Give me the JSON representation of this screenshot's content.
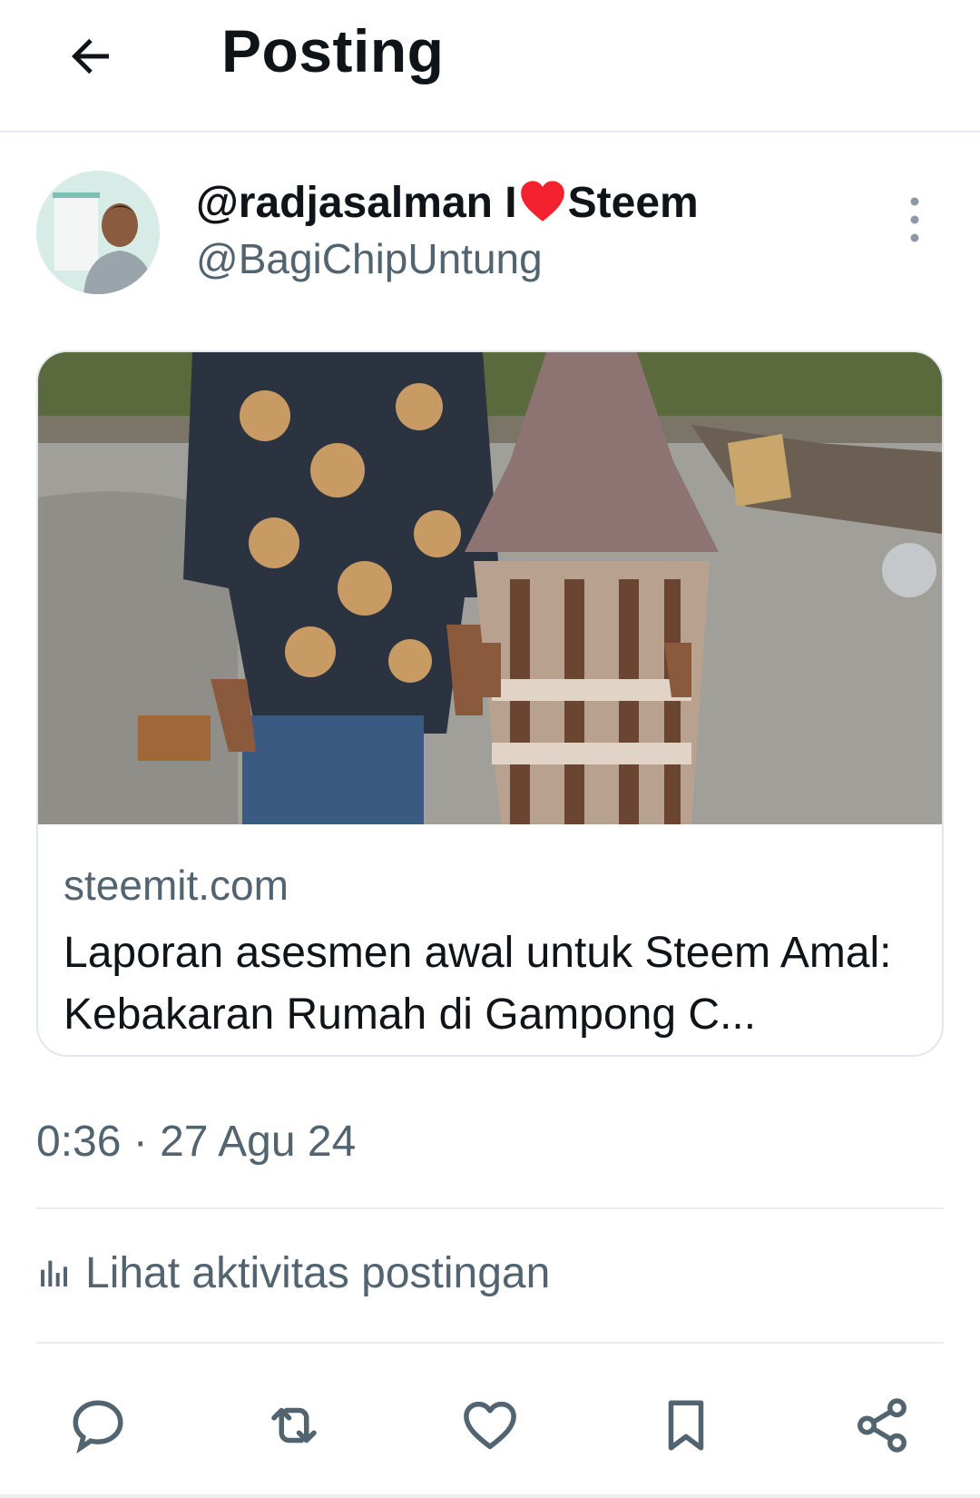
{
  "header": {
    "title": "Posting",
    "back_icon": "arrow-left-icon"
  },
  "author": {
    "display_name_prefix": "@radjasalman I",
    "display_name_suffix": "Steem",
    "heart_color": "#f4212e",
    "handle": "@BagiChipUntung"
  },
  "link_card": {
    "domain": "steemit.com",
    "title": "Laporan asesmen awal untuk Steem Amal: Kebakaran Rumah di Gampong C..."
  },
  "timestamp": "0:36 · 27 Agu 24",
  "activity": {
    "label": "Lihat aktivitas postingan",
    "icon": "bar-chart-icon"
  },
  "actions": [
    {
      "name": "reply",
      "icon": "comment-icon"
    },
    {
      "name": "repost",
      "icon": "repost-icon"
    },
    {
      "name": "like",
      "icon": "heart-icon"
    },
    {
      "name": "bookmark",
      "icon": "bookmark-icon"
    },
    {
      "name": "share",
      "icon": "share-icon"
    }
  ],
  "colors": {
    "text": "#0f1419",
    "secondary": "#536471",
    "divider": "#e6ecf0"
  }
}
